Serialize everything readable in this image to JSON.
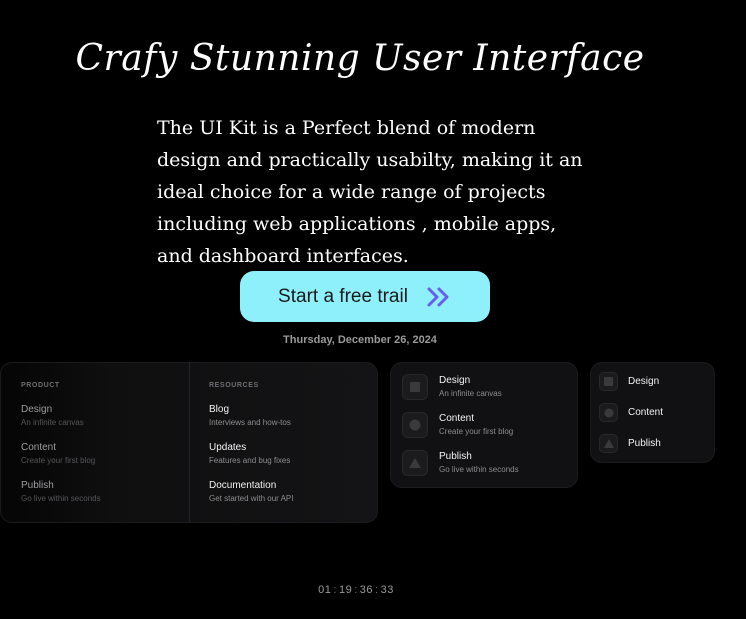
{
  "hero": {
    "title": "Crafy Stunning User Interface",
    "description": "The UI Kit is a Perfect blend of modern design and practically usabilty, making it an ideal choice for a wide range of projects including web applications , mobile apps, and dashboard interfaces."
  },
  "cta": {
    "label": "Start a free trail",
    "icon": "double-chevron-right-icon",
    "background": "#8ef0fb",
    "icon_color": "#6b5cf0"
  },
  "date": "Thursday, December 26, 2024",
  "mega_menu": {
    "product": {
      "heading": "PRODUCT",
      "items": [
        {
          "title": "Design",
          "subtitle": "An infinite canvas"
        },
        {
          "title": "Content",
          "subtitle": "Create your first blog"
        },
        {
          "title": "Publish",
          "subtitle": "Go live within seconds"
        }
      ]
    },
    "resources": {
      "heading": "RESOURCES",
      "items": [
        {
          "title": "Blog",
          "subtitle": "Interviews and how-tos"
        },
        {
          "title": "Updates",
          "subtitle": "Features and bug fixes"
        },
        {
          "title": "Documentation",
          "subtitle": "Get started with our API"
        }
      ]
    }
  },
  "icon_menu": {
    "items": [
      {
        "title": "Design",
        "subtitle": "An infinite canvas",
        "icon": "square-icon"
      },
      {
        "title": "Content",
        "subtitle": "Create your first blog",
        "icon": "circle-icon"
      },
      {
        "title": "Publish",
        "subtitle": "Go live within seconds",
        "icon": "triangle-icon"
      }
    ]
  },
  "compact_menu": {
    "items": [
      {
        "title": "Design",
        "icon": "square-icon"
      },
      {
        "title": "Content",
        "icon": "circle-icon"
      },
      {
        "title": "Publish",
        "icon": "triangle-icon"
      }
    ]
  },
  "clock": {
    "days": "01",
    "hours": "19",
    "minutes": "36",
    "seconds": "33",
    "separator": ":"
  }
}
